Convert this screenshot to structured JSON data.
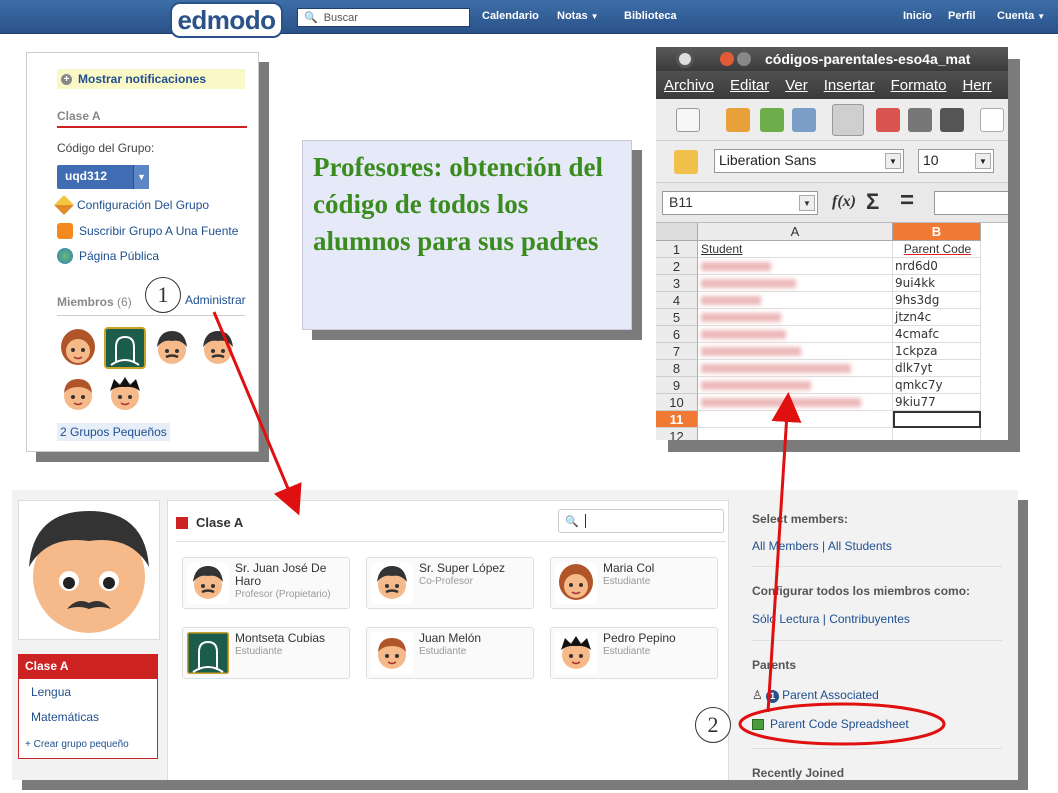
{
  "topbar": {
    "logo": "edmodo",
    "search_placeholder": "Buscar",
    "nav": [
      "Calendario",
      "Notas",
      "Biblioteca"
    ],
    "right": [
      "Inicio",
      "Perfil",
      "Cuenta"
    ]
  },
  "left_panel": {
    "show_notifications": "Mostrar notificaciones",
    "group_heading": "Clase A",
    "code_label": "Código del Grupo:",
    "code_value": "uqd312",
    "links": [
      "Configuración Del Grupo",
      "Suscribir Grupo A Una Fuente",
      "Página Pública"
    ],
    "members_label": "Miembros",
    "members_count": "(6)",
    "admin_link": "Administrar",
    "small_groups": "2 Grupos Pequeños"
  },
  "callout": {
    "title": "Profesores: obtención del código de todos los alumnos para sus padres",
    "num1": "1",
    "num2": "2"
  },
  "spreadsheet": {
    "window_title": "códigos-parentales-eso4a_mat",
    "menu": [
      "Archivo",
      "Editar",
      "Ver",
      "Insertar",
      "Formato",
      "Herr"
    ],
    "font_name": "Liberation Sans",
    "font_size": "10",
    "cell_ref": "B11",
    "col_a": "A",
    "col_b": "B",
    "header_a": "Student",
    "header_b": "Parent Code",
    "row_numbers": [
      "1",
      "2",
      "3",
      "4",
      "5",
      "6",
      "7",
      "8",
      "9",
      "10",
      "11",
      "12"
    ],
    "codes": [
      "nrd6d0",
      "9ui4kk",
      "9hs3dg",
      "jtzn4c",
      "4cmafc",
      "1ckpza",
      "dlk7yt",
      "qmkc7y",
      "9kiu77"
    ]
  },
  "group_page": {
    "sidebar_head": "Clase A",
    "sidebar_items": [
      "Lengua",
      "Matemáticas"
    ],
    "create_small": "+ Crear grupo pequeño",
    "panel_title": "Clase A",
    "members": [
      {
        "name": "Sr. Juan José De Haro",
        "role": "Profesor (Propietario)",
        "avatar": "teacher-avatar"
      },
      {
        "name": "Sr. Super López",
        "role": "Co-Profesor",
        "avatar": "teacher-avatar"
      },
      {
        "name": "Maria Col",
        "role": "Estudiante",
        "avatar": "girl-avatar"
      },
      {
        "name": "Montseta Cubias",
        "role": "Estudiante",
        "avatar": "default-avatar"
      },
      {
        "name": "Juan Melón",
        "role": "Estudiante",
        "avatar": "boy-avatar"
      },
      {
        "name": "Pedro Pepino",
        "role": "Estudiante",
        "avatar": "boy2-avatar"
      }
    ],
    "right": {
      "select_members": "Select members:",
      "all_members": "All Members",
      "all_students": "All Students",
      "configure_all": "Configurar todos los miembros como:",
      "read_only": "Sólo Lectura",
      "contributors": "Contribuyentes",
      "parents": "Parents",
      "parent_assoc_count": "1",
      "parent_associated": "Parent Associated",
      "parent_spreadsheet": "Parent Code Spreadsheet",
      "recently_joined": "Recently Joined"
    }
  },
  "colors": {
    "brand": "#2a5289",
    "accent_red": "#cc2222",
    "callout_green": "#3a8c1e"
  }
}
